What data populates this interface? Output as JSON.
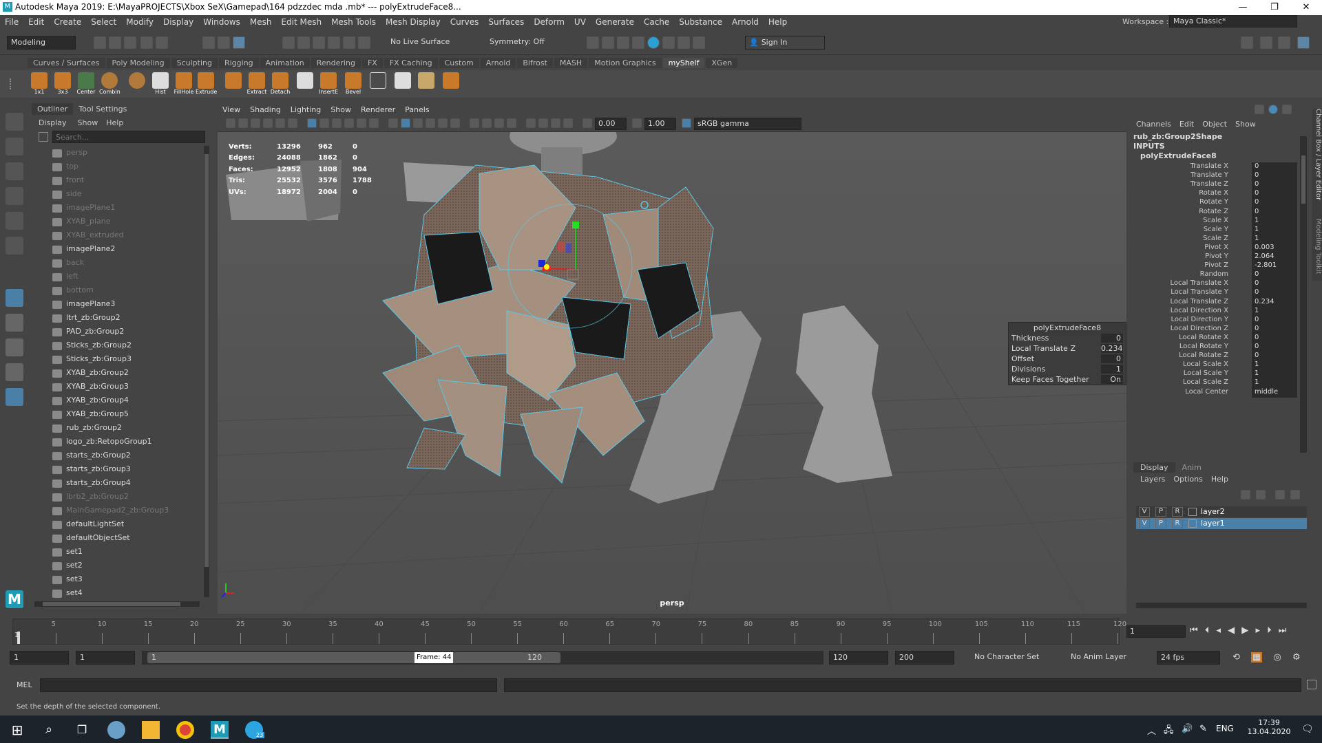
{
  "window": {
    "title": "Autodesk Maya 2019: E:\\MayaPROJECTS\\Xbox SeX\\Gamepad\\164 pdzzdec mda .mb*  ---  polyExtrudeFace8...",
    "min": "—",
    "max": "❐",
    "close": "✕"
  },
  "menu": [
    "File",
    "Edit",
    "Create",
    "Select",
    "Modify",
    "Display",
    "Windows",
    "Mesh",
    "Edit Mesh",
    "Mesh Tools",
    "Mesh Display",
    "Curves",
    "Surfaces",
    "Deform",
    "UV",
    "Generate",
    "Cache",
    "Substance",
    "Arnold",
    "Help"
  ],
  "workspace": {
    "label": "Workspace :",
    "value": "Maya Classic*"
  },
  "toolbar": {
    "mode": "Modeling",
    "live_surface": "No Live Surface",
    "symmetry": "Symmetry: Off",
    "sign_in": "Sign In"
  },
  "shelf_tabs": [
    "Curves / Surfaces",
    "Poly Modeling",
    "Sculpting",
    "Rigging",
    "Animation",
    "Rendering",
    "FX",
    "FX Caching",
    "Custom",
    "Arnold",
    "Bifrost",
    "MASH",
    "Motion Graphics",
    "myShelf",
    "XGen"
  ],
  "shelf_active": "myShelf",
  "shelf_items": [
    "1x1",
    "3x3",
    "Center",
    "Combin",
    "",
    "Hist",
    "FillHole",
    "Extrude",
    "",
    "Extract",
    "Detach",
    "",
    "InsertE",
    "Bevel"
  ],
  "outliner": {
    "tabs": [
      "Outliner",
      "Tool Settings"
    ],
    "menu": [
      "Display",
      "Show",
      "Help"
    ],
    "search": "Search...",
    "items": [
      {
        "label": "persp",
        "dim": true,
        "icon": "camera-icon"
      },
      {
        "label": "top",
        "dim": true,
        "icon": "camera-icon"
      },
      {
        "label": "front",
        "dim": true,
        "icon": "camera-icon"
      },
      {
        "label": "side",
        "dim": true,
        "icon": "camera-icon"
      },
      {
        "label": "imagePlane1",
        "dim": true,
        "icon": "image-plane-icon"
      },
      {
        "label": "XYAB_plane",
        "dim": true,
        "icon": "transform-icon"
      },
      {
        "label": "XYAB_extruded",
        "dim": true,
        "icon": "transform-icon"
      },
      {
        "label": "imagePlane2",
        "dim": false,
        "icon": "image-plane-icon"
      },
      {
        "label": "back",
        "dim": true,
        "icon": "camera-icon"
      },
      {
        "label": "left",
        "dim": true,
        "icon": "camera-icon"
      },
      {
        "label": "bottom",
        "dim": true,
        "icon": "camera-icon"
      },
      {
        "label": "imagePlane3",
        "dim": false,
        "icon": "image-plane-icon"
      },
      {
        "label": "ltrt_zb:Group2",
        "dim": false,
        "icon": "transform-icon"
      },
      {
        "label": "PAD_zb:Group2",
        "dim": false,
        "icon": "transform-icon"
      },
      {
        "label": "Sticks_zb:Group2",
        "dim": false,
        "icon": "transform-icon"
      },
      {
        "label": "Sticks_zb:Group3",
        "dim": false,
        "icon": "transform-icon"
      },
      {
        "label": "XYAB_zb:Group2",
        "dim": false,
        "icon": "transform-icon"
      },
      {
        "label": "XYAB_zb:Group3",
        "dim": false,
        "icon": "transform-icon"
      },
      {
        "label": "XYAB_zb:Group4",
        "dim": false,
        "icon": "transform-icon"
      },
      {
        "label": "XYAB_zb:Group5",
        "dim": false,
        "icon": "transform-icon"
      },
      {
        "label": "rub_zb:Group2",
        "dim": false,
        "icon": "transform-icon"
      },
      {
        "label": "logo_zb:RetopoGroup1",
        "dim": false,
        "icon": "transform-icon"
      },
      {
        "label": "starts_zb:Group2",
        "dim": false,
        "icon": "transform-icon"
      },
      {
        "label": "starts_zb:Group3",
        "dim": false,
        "icon": "transform-icon"
      },
      {
        "label": "starts_zb:Group4",
        "dim": false,
        "icon": "transform-icon"
      },
      {
        "label": "lbrb2_zb:Group2",
        "dim": true,
        "icon": "transform-icon"
      },
      {
        "label": "MainGamepad2_zb:Group3",
        "dim": true,
        "icon": "transform-icon"
      },
      {
        "label": "defaultLightSet",
        "dim": false,
        "icon": "set-icon"
      },
      {
        "label": "defaultObjectSet",
        "dim": false,
        "icon": "set-icon"
      },
      {
        "label": "set1",
        "dim": false,
        "icon": "set-icon"
      },
      {
        "label": "set2",
        "dim": false,
        "icon": "set-icon"
      },
      {
        "label": "set3",
        "dim": false,
        "icon": "set-icon"
      },
      {
        "label": "set4",
        "dim": false,
        "icon": "set-icon"
      }
    ]
  },
  "viewport": {
    "menu": [
      "View",
      "Shading",
      "Lighting",
      "Show",
      "Renderer",
      "Panels"
    ],
    "field1": "0.00",
    "field2": "1.00",
    "colorspace": "sRGB gamma",
    "camera": "persp",
    "hud": [
      {
        "label": "Verts:",
        "a": "13296",
        "b": "962",
        "c": "0"
      },
      {
        "label": "Edges:",
        "a": "24088",
        "b": "1862",
        "c": "0"
      },
      {
        "label": "Faces:",
        "a": "12952",
        "b": "1808",
        "c": "904"
      },
      {
        "label": "Tris:",
        "a": "25532",
        "b": "3576",
        "c": "1788"
      },
      {
        "label": "UVs:",
        "a": "18972",
        "b": "2004",
        "c": "0"
      }
    ],
    "inview": {
      "title": "polyExtrudeFace8",
      "rows": [
        {
          "l": "Thickness",
          "v": "0"
        },
        {
          "l": "Local Translate Z",
          "v": "0.234"
        },
        {
          "l": "Offset",
          "v": "0"
        },
        {
          "l": "Divisions",
          "v": "1"
        },
        {
          "l": "Keep Faces Together",
          "v": "On"
        }
      ]
    }
  },
  "channelbox": {
    "menu": [
      "Channels",
      "Edit",
      "Object",
      "Show"
    ],
    "node": "rub_zb:Group2Shape",
    "inputs": "INPUTS",
    "input_node": "polyExtrudeFace8",
    "attrs": [
      {
        "l": "Translate X",
        "v": "0"
      },
      {
        "l": "Translate Y",
        "v": "0"
      },
      {
        "l": "Translate Z",
        "v": "0"
      },
      {
        "l": "Rotate X",
        "v": "0"
      },
      {
        "l": "Rotate Y",
        "v": "0"
      },
      {
        "l": "Rotate Z",
        "v": "0"
      },
      {
        "l": "Scale X",
        "v": "1"
      },
      {
        "l": "Scale Y",
        "v": "1"
      },
      {
        "l": "Scale Z",
        "v": "1"
      },
      {
        "l": "Pivot X",
        "v": "0.003"
      },
      {
        "l": "Pivot Y",
        "v": "2.064"
      },
      {
        "l": "Pivot Z",
        "v": "-2.801"
      },
      {
        "l": "Random",
        "v": "0"
      },
      {
        "l": "Local Translate X",
        "v": "0"
      },
      {
        "l": "Local Translate Y",
        "v": "0"
      },
      {
        "l": "Local Translate Z",
        "v": "0.234"
      },
      {
        "l": "Local Direction X",
        "v": "1"
      },
      {
        "l": "Local Direction Y",
        "v": "0"
      },
      {
        "l": "Local Direction Z",
        "v": "0"
      },
      {
        "l": "Local Rotate X",
        "v": "0"
      },
      {
        "l": "Local Rotate Y",
        "v": "0"
      },
      {
        "l": "Local Rotate Z",
        "v": "0"
      },
      {
        "l": "Local Scale X",
        "v": "1"
      },
      {
        "l": "Local Scale Y",
        "v": "1"
      },
      {
        "l": "Local Scale Z",
        "v": "1"
      },
      {
        "l": "Local Center",
        "v": "middle"
      }
    ],
    "side_tabs": [
      "Channel Box / Layer Editor",
      "Modeling Toolkit"
    ]
  },
  "layers": {
    "tabs": [
      "Display",
      "Anim"
    ],
    "menu": [
      "Layers",
      "Options",
      "Help"
    ],
    "rows": [
      {
        "v": "V",
        "p": "P",
        "r": "R",
        "name": "layer2",
        "selected": false
      },
      {
        "v": "V",
        "p": "P",
        "r": "R",
        "name": "layer1",
        "selected": true
      }
    ]
  },
  "timeline": {
    "ticks": [
      "5",
      "10",
      "15",
      "20",
      "25",
      "30",
      "35",
      "40",
      "45",
      "50",
      "55",
      "60",
      "65",
      "70",
      "75",
      "80",
      "85",
      "90",
      "95",
      "100",
      "105",
      "110",
      "115",
      "120"
    ],
    "start_marker": "1",
    "current": "1"
  },
  "range": {
    "start": "1",
    "start2": "1",
    "slider_start": "1",
    "frame_tip": "Frame: 44",
    "slider_end": "120",
    "end": "120",
    "end2": "200",
    "char_set": "No Character Set",
    "anim_layer": "No Anim Layer",
    "fps": "24 fps"
  },
  "mel": {
    "label": "MEL"
  },
  "help": "Set the depth of the selected component.",
  "taskbar": {
    "lang": "ENG",
    "time": "17:39",
    "date": "13.04.2020",
    "badge": "23"
  },
  "colors": {
    "accent": "#5bc8e8",
    "selection": "#4a7fa8",
    "highlight": "#1e9cb5"
  }
}
